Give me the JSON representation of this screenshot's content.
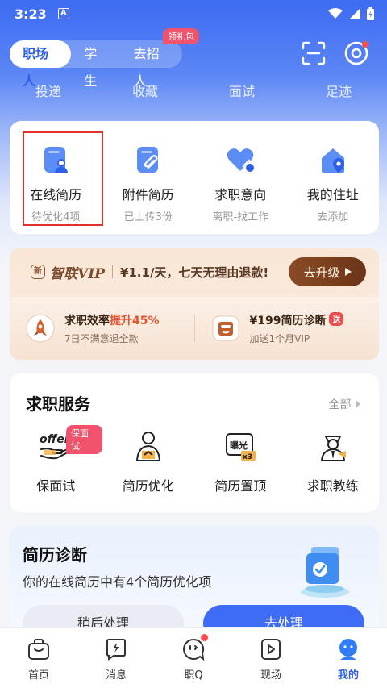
{
  "status_bar": {
    "time": "3:23",
    "app_icon_letter": "A"
  },
  "header": {
    "role_tabs": [
      {
        "label": "职场人",
        "active": true
      },
      {
        "label": "学生",
        "active": false
      },
      {
        "label": "去招人",
        "active": false
      }
    ],
    "gift_badge": "领礼包",
    "quick_links": [
      "投递",
      "收藏",
      "面试",
      "足迹"
    ]
  },
  "resume_card": {
    "items": [
      {
        "title": "在线简历",
        "subtitle": "待优化4项",
        "icon": "online-resume-icon"
      },
      {
        "title": "附件简历",
        "subtitle": "已上传3份",
        "icon": "attachment-resume-icon"
      },
      {
        "title": "求职意向",
        "subtitle": "离职-找工作",
        "icon": "job-intention-icon"
      },
      {
        "title": "我的住址",
        "subtitle": "去添加",
        "icon": "address-icon"
      }
    ]
  },
  "vip": {
    "new_tag": "新",
    "brand": "智联VIP",
    "slogan": "¥1.1/天，七天无理由退款!",
    "upgrade_label": "去升级",
    "benefits": [
      {
        "title_prefix": "求职效率",
        "title_highlight": "提升45%",
        "subtitle": "7日不满意退全款"
      },
      {
        "title": "¥199简历诊断",
        "badge": "送",
        "subtitle": "加送1个月VIP"
      }
    ]
  },
  "services": {
    "title": "求职服务",
    "all_label": "全部",
    "items": [
      {
        "label": "保面试",
        "badge": "保面试",
        "icon_text": "offer"
      },
      {
        "label": "简历优化"
      },
      {
        "label": "简历置顶",
        "icon_text": "曝光",
        "icon_text2": "x3"
      },
      {
        "label": "求职教练"
      }
    ]
  },
  "diagnosis": {
    "title": "简历诊断",
    "description": "你的在线简历中有4个简历优化项",
    "later_label": "稍后处理",
    "go_label": "去处理"
  },
  "tabbar": {
    "tabs": [
      {
        "label": "首页",
        "active": false
      },
      {
        "label": "消息",
        "active": false
      },
      {
        "label": "职Q",
        "active": false
      },
      {
        "label": "现场",
        "active": false
      },
      {
        "label": "我的",
        "active": true
      }
    ]
  },
  "colors": {
    "primary": "#3f6cf5",
    "highlight_border": "#e0322a",
    "badge": "#f0536b",
    "vip_brown": "#7a4b2c"
  }
}
